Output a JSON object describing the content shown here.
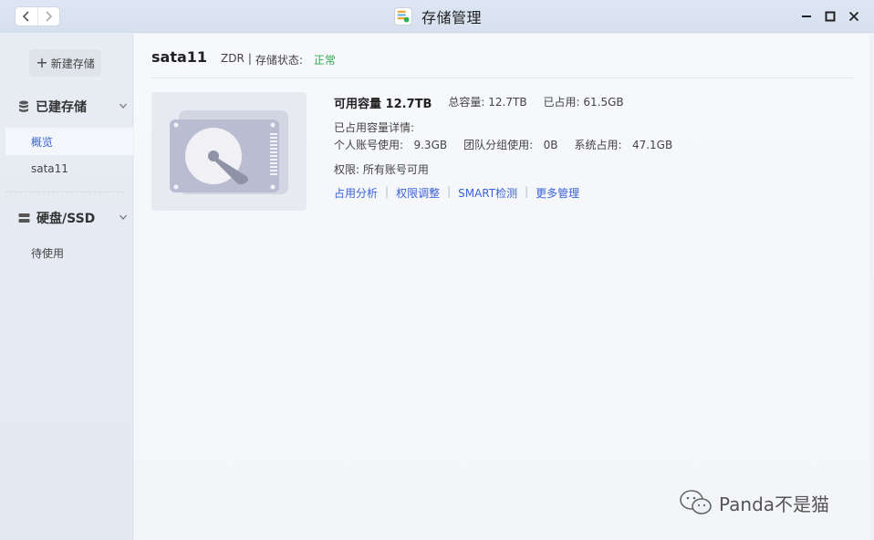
{
  "window": {
    "title": "存储管理",
    "icons": {
      "back": "chevron-left-icon",
      "forward": "chevron-right-icon",
      "minimize": "minimize-icon",
      "maximize": "maximize-icon",
      "close": "close-icon"
    }
  },
  "sidebar": {
    "new_storage_label": "新建存储",
    "sections": [
      {
        "label": "已建存储",
        "icon": "database-icon",
        "items": [
          "概览",
          "sata11"
        ]
      },
      {
        "label": "硬盘/SSD",
        "icon": "drive-icon",
        "items": [
          "待使用"
        ]
      }
    ],
    "active_item": "概览"
  },
  "main": {
    "pool_name": "sata11",
    "raid": "ZDR",
    "sep": "|",
    "status_label": "存储状态:",
    "status_value": "正常",
    "available_label": "可用容量",
    "available_value": "12.7TB",
    "total_text": "总容量: 12.7TB",
    "used_text": "已占用: 61.5GB",
    "detail_heading": "已占用容量详情:",
    "personal_text": "个人账号使用:   9.3GB",
    "team_text": "团队分组使用:   0B",
    "system_text": "系统占用:   47.1GB",
    "permission_text": "权限: 所有账号可用",
    "links": [
      "占用分析",
      "权限调整",
      "SMART检测",
      "更多管理"
    ],
    "link_sep": "|"
  },
  "watermark": {
    "text": "Panda不是猫"
  },
  "colors": {
    "accent": "#3b62d6",
    "ok": "#34a853"
  }
}
